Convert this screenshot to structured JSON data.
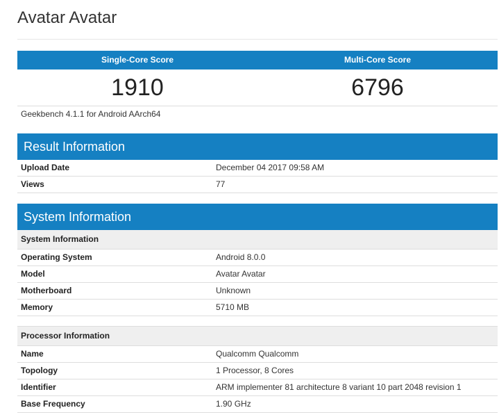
{
  "page": {
    "title": "Avatar Avatar"
  },
  "scores": {
    "single_core_label": "Single-Core Score",
    "multi_core_label": "Multi-Core Score",
    "single_core_value": "1910",
    "multi_core_value": "6796",
    "benchmark_version": "Geekbench 4.1.1 for Android AArch64"
  },
  "result_information": {
    "title": "Result Information",
    "rows": [
      {
        "label": "Upload Date",
        "value": "December 04 2017 09:58 AM"
      },
      {
        "label": "Views",
        "value": "77"
      }
    ]
  },
  "system_information": {
    "title": "System Information",
    "system_subhead": "System Information",
    "system_rows": [
      {
        "label": "Operating System",
        "value": "Android 8.0.0"
      },
      {
        "label": "Model",
        "value": "Avatar Avatar"
      },
      {
        "label": "Motherboard",
        "value": "Unknown"
      },
      {
        "label": "Memory",
        "value": "5710 MB"
      }
    ],
    "processor_subhead": "Processor Information",
    "processor_rows": [
      {
        "label": "Name",
        "value": "Qualcomm Qualcomm"
      },
      {
        "label": "Topology",
        "value": "1 Processor, 8 Cores"
      },
      {
        "label": "Identifier",
        "value": "ARM implementer 81 architecture 8 variant 10 part 2048 revision 1"
      },
      {
        "label": "Base Frequency",
        "value": "1.90 GHz"
      }
    ]
  },
  "colors": {
    "header_blue": "#1580c2",
    "subhead_gray": "#efefef"
  }
}
